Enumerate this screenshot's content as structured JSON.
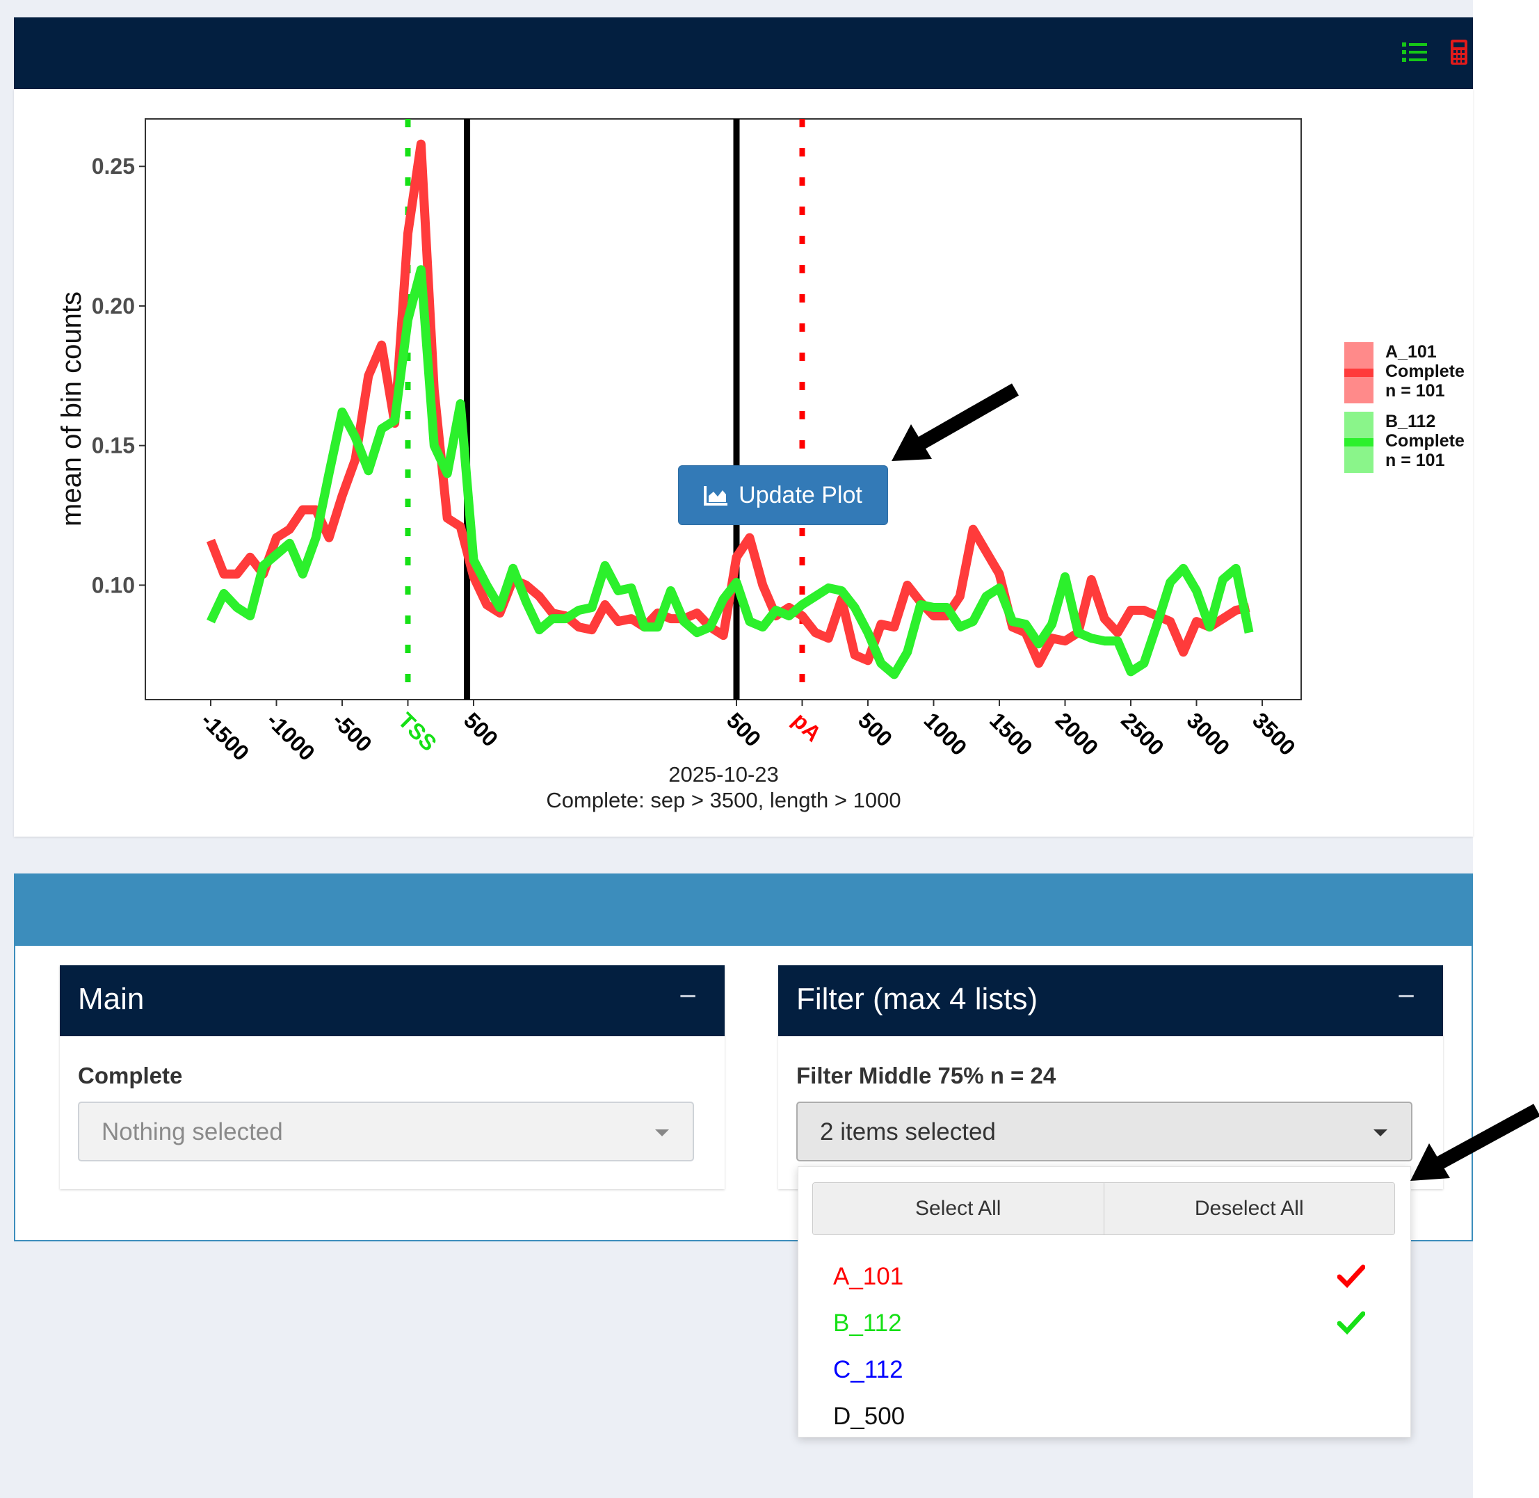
{
  "navbar": {
    "icons": [
      {
        "name": "list-icon",
        "color": "#16c716"
      },
      {
        "name": "calculator-icon",
        "color": "#e21b1b"
      }
    ]
  },
  "plot": {
    "update_button_label": "Update Plot",
    "date_caption": "2025-10-23",
    "subtitle_caption": "Complete: sep > 3500, length > 1000"
  },
  "chart_data": {
    "type": "line",
    "ylabel": "mean of bin counts",
    "xlabel": "",
    "ylim": [
      0.059,
      0.267
    ],
    "yticks": [
      0.1,
      0.15,
      0.2,
      0.25
    ],
    "ytick_labels": [
      "0.10",
      "0.15",
      "0.20",
      "0.25"
    ],
    "grid": false,
    "legend_position": "right",
    "x_bins": 80,
    "xtick_labels": [
      {
        "bin": 0,
        "text": "-1500",
        "color": "#000000"
      },
      {
        "bin": 5,
        "text": "-1000",
        "color": "#000000"
      },
      {
        "bin": 10,
        "text": "-500",
        "color": "#000000"
      },
      {
        "bin": 15,
        "text": "TSS",
        "color": "#16e016"
      },
      {
        "bin": 20,
        "text": "500",
        "color": "#000000"
      },
      {
        "bin": 40,
        "text": "500",
        "color": "#000000"
      },
      {
        "bin": 45,
        "text": "pA",
        "color": "#ff0000"
      },
      {
        "bin": 50,
        "text": "500",
        "color": "#000000"
      },
      {
        "bin": 55,
        "text": "1000",
        "color": "#000000"
      },
      {
        "bin": 60,
        "text": "1500",
        "color": "#000000"
      },
      {
        "bin": 65,
        "text": "2000",
        "color": "#000000"
      },
      {
        "bin": 70,
        "text": "2500",
        "color": "#000000"
      },
      {
        "bin": 75,
        "text": "3000",
        "color": "#000000"
      },
      {
        "bin": 80,
        "text": "3500",
        "color": "#000000"
      }
    ],
    "vlines": [
      {
        "bin": 15,
        "style": "dotted",
        "color": "#16e016"
      },
      {
        "bin": 19.5,
        "style": "solid",
        "color": "#000000"
      },
      {
        "bin": 40,
        "style": "solid",
        "color": "#000000"
      },
      {
        "bin": 45,
        "style": "dotted",
        "color": "#ff0000"
      }
    ],
    "series": [
      {
        "name": "A_101\nComplete\nn = 101",
        "color": "#ff3b3b",
        "values": [
          0.116,
          0.104,
          0.104,
          0.11,
          0.104,
          0.117,
          0.12,
          0.127,
          0.127,
          0.117,
          0.132,
          0.145,
          0.175,
          0.186,
          0.158,
          0.226,
          0.258,
          0.17,
          0.124,
          0.121,
          0.103,
          0.093,
          0.09,
          0.102,
          0.1,
          0.096,
          0.09,
          0.089,
          0.085,
          0.084,
          0.093,
          0.087,
          0.088,
          0.085,
          0.09,
          0.088,
          0.088,
          0.09,
          0.085,
          0.082,
          0.11,
          0.117,
          0.1,
          0.089,
          0.092,
          0.089,
          0.083,
          0.081,
          0.095,
          0.075,
          0.073,
          0.086,
          0.085,
          0.1,
          0.094,
          0.089,
          0.089,
          0.096,
          0.12,
          0.112,
          0.104,
          0.085,
          0.083,
          0.072,
          0.081,
          0.08,
          0.083,
          0.102,
          0.088,
          0.083,
          0.091,
          0.091,
          0.089,
          0.087,
          0.076,
          0.087,
          0.085,
          0.088,
          0.091,
          0.092
        ]
      },
      {
        "name": "B_112\nComplete\nn = 101",
        "color": "#2cf02c",
        "values": [
          0.087,
          0.097,
          0.092,
          0.089,
          0.107,
          0.111,
          0.115,
          0.104,
          0.117,
          0.14,
          0.162,
          0.153,
          0.141,
          0.156,
          0.159,
          0.195,
          0.213,
          0.15,
          0.14,
          0.165,
          0.109,
          0.1,
          0.092,
          0.106,
          0.094,
          0.084,
          0.088,
          0.088,
          0.091,
          0.092,
          0.107,
          0.098,
          0.099,
          0.085,
          0.085,
          0.098,
          0.087,
          0.083,
          0.085,
          0.095,
          0.101,
          0.087,
          0.085,
          0.091,
          0.089,
          0.093,
          0.096,
          0.099,
          0.098,
          0.092,
          0.083,
          0.072,
          0.068,
          0.076,
          0.093,
          0.092,
          0.092,
          0.085,
          0.087,
          0.096,
          0.099,
          0.087,
          0.086,
          0.079,
          0.086,
          0.103,
          0.083,
          0.081,
          0.08,
          0.08,
          0.069,
          0.072,
          0.086,
          0.101,
          0.106,
          0.098,
          0.085,
          0.102,
          0.106,
          0.083
        ]
      }
    ]
  },
  "legend": [
    {
      "line1": "A_101",
      "line2": "Complete",
      "line3": "n = 101",
      "color": "#ff3b3b",
      "fill": "#ff8a8a"
    },
    {
      "line1": "B_112",
      "line2": "Complete",
      "line3": "n = 101",
      "color": "#2cf02c",
      "fill": "#8af58a"
    }
  ],
  "main_card": {
    "title": "Main",
    "collapse_glyph": "−",
    "field_label": "Complete",
    "select_placeholder": "Nothing selected"
  },
  "filter_card": {
    "title": "Filter (max 4 lists)",
    "collapse_glyph": "−",
    "field_label": "Filter Middle 75% n = 24",
    "select_value": "2 items selected"
  },
  "dropdown": {
    "select_all_label": "Select All",
    "deselect_all_label": "Deselect All",
    "options": [
      {
        "label": "A_101",
        "color": "#ff0000",
        "selected": true
      },
      {
        "label": "B_112",
        "color": "#16e016",
        "selected": true
      },
      {
        "label": "C_112",
        "color": "#0000ff",
        "selected": false
      },
      {
        "label": "D_500",
        "color": "#111111",
        "selected": false
      }
    ]
  }
}
